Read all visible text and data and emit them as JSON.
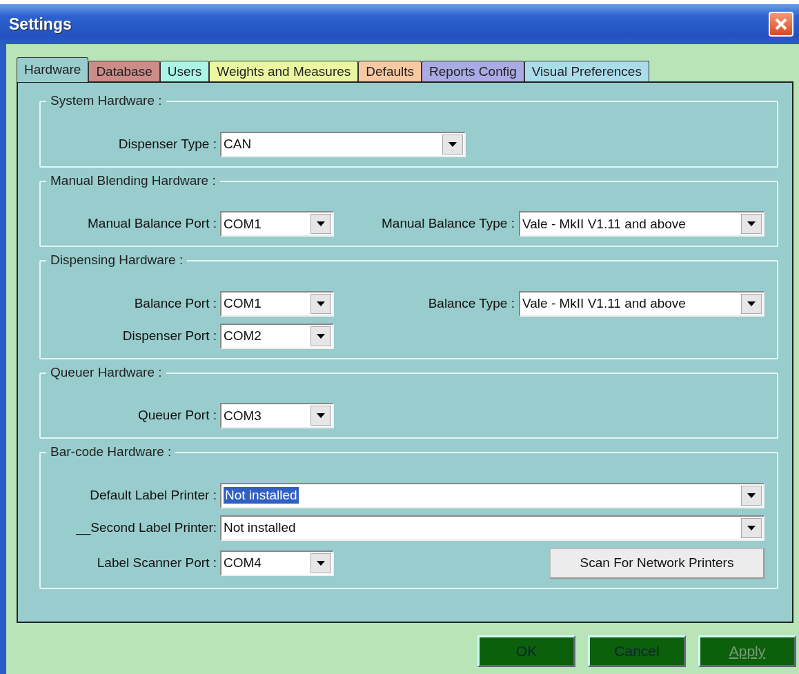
{
  "window": {
    "title": "Settings"
  },
  "tabs": [
    {
      "label": "Hardware",
      "color": "#99cccc",
      "selected": true
    },
    {
      "label": "Database",
      "color": "#cc8c88",
      "selected": false
    },
    {
      "label": "Users",
      "color": "#aaf5e6",
      "selected": false
    },
    {
      "label": "Weights and Measures",
      "color": "#eaf7a0",
      "selected": false
    },
    {
      "label": "Defaults",
      "color": "#f8c8a0",
      "selected": false
    },
    {
      "label": "Reports Config",
      "color": "#aaaae4",
      "selected": false
    },
    {
      "label": "Visual Preferences",
      "color": "#aadcea",
      "selected": false
    }
  ],
  "groups": [
    {
      "title": "System Hardware :",
      "rows": [
        [
          {
            "kind": "type",
            "label": "Dispenser Type :",
            "value": "CAN"
          }
        ]
      ]
    },
    {
      "title": "Manual Blending Hardware :",
      "rows": [
        [
          {
            "kind": "port",
            "label": "Manual Balance Port :",
            "value": "COM1"
          },
          {
            "kind": "type",
            "label": "Manual Balance Type :",
            "value": "Vale - MkII V1.11 and above"
          }
        ]
      ]
    },
    {
      "title": "Dispensing Hardware :",
      "rows": [
        [
          {
            "kind": "port",
            "label": "Balance Port :",
            "value": "COM1"
          },
          {
            "kind": "type",
            "label": "Balance Type :",
            "value": "Vale - MkII V1.11 and above"
          }
        ],
        [
          {
            "kind": "port",
            "label": "Dispenser Port :",
            "value": "COM2"
          }
        ]
      ]
    },
    {
      "title": "Queuer Hardware :",
      "rows": [
        [
          {
            "kind": "port",
            "label": "Queuer Port :",
            "value": "COM3"
          }
        ]
      ]
    },
    {
      "title": "Bar-code Hardware :",
      "rows": [
        [
          {
            "kind": "printer",
            "label": "Default Label Printer :",
            "value": "Not installed",
            "value_selected": true
          }
        ],
        [
          {
            "kind": "printer",
            "label": "__Second Label Printer:",
            "value": "Not installed",
            "value_selected": false
          }
        ],
        [
          {
            "kind": "port",
            "label": "Label Scanner Port :",
            "value": "COM4"
          },
          {
            "kind": "button",
            "label": "Scan For Network Printers"
          }
        ]
      ]
    }
  ],
  "buttons": [
    {
      "label": "OK",
      "disabled": false
    },
    {
      "label": "Cancel",
      "disabled": false
    },
    {
      "label": "Apply",
      "disabled": true
    }
  ]
}
